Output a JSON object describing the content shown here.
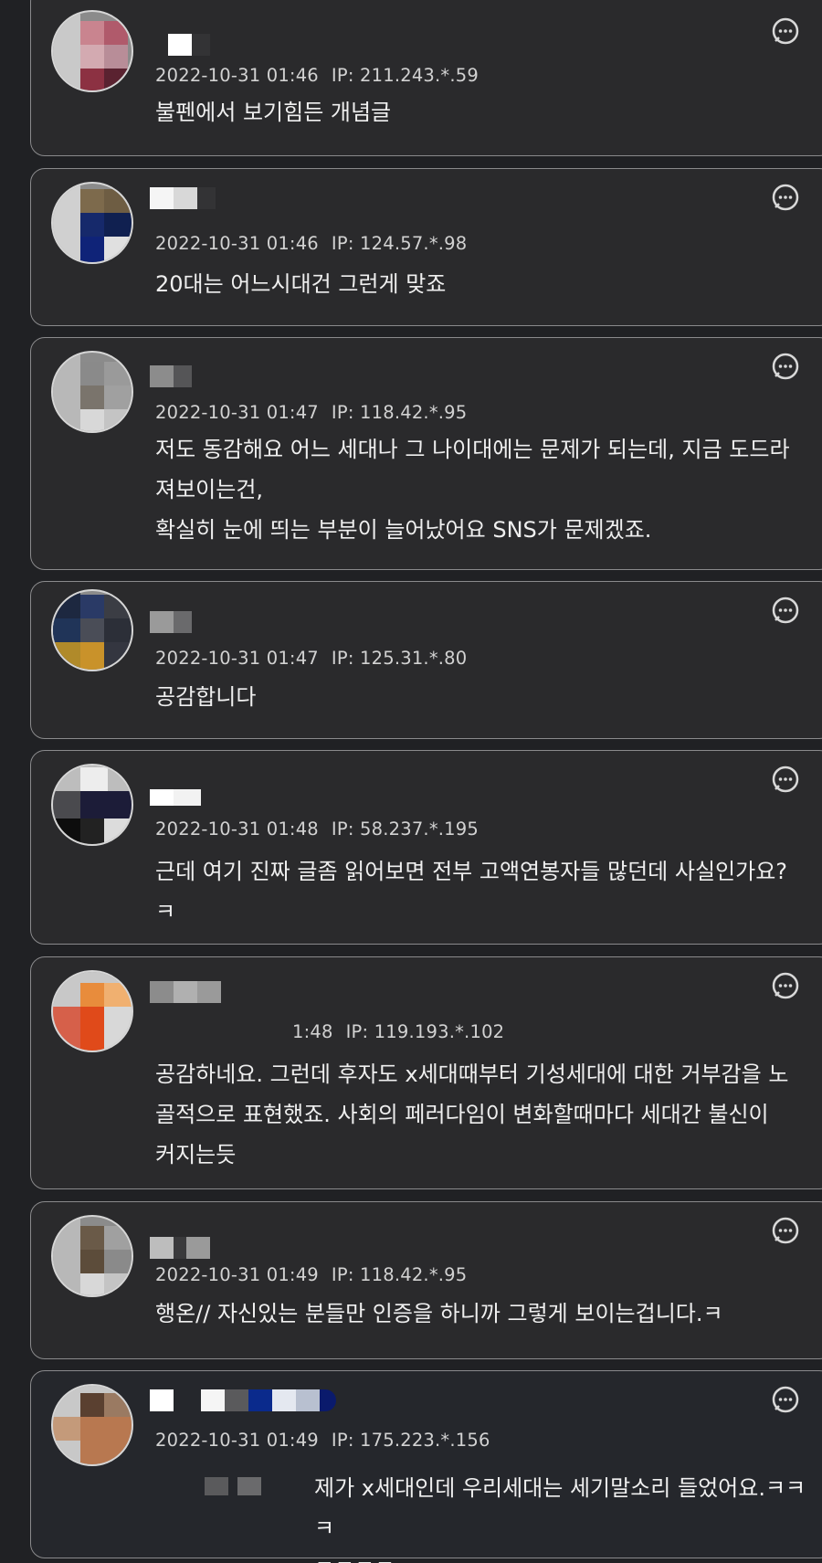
{
  "comments": [
    {
      "date": "2022-10-31 01:46",
      "ip": "IP: 211.243.*.59",
      "text": "불펜에서 보기힘든 개념글"
    },
    {
      "date": "2022-10-31 01:46",
      "ip": "IP: 124.57.*.98",
      "text": "20대는 어느시대건 그런게 맞죠"
    },
    {
      "date": "2022-10-31 01:47",
      "ip": "IP: 118.42.*.95",
      "text": "저도 동감해요 어느 세대나 그 나이대에는 문제가 되는데, 지금 도드라\n져보이는건,\n확실히 눈에 띄는 부분이 늘어났어요 SNS가 문제겠죠."
    },
    {
      "date": "2022-10-31 01:47",
      "ip": "IP: 125.31.*.80",
      "text": "공감합니다"
    },
    {
      "date": "2022-10-31 01:48",
      "ip": "IP: 58.237.*.195",
      "text": "근데 여기 진짜 글좀 읽어보면 전부 고액연봉자들 많던데 사실인가요?\nㅋ"
    },
    {
      "date": "1:48",
      "ip": "IP: 119.193.*.102",
      "text": "공감하네요. 그런데 후자도 x세대때부터 기성세대에 대한 거부감을 노\n골적으로 표현했죠. 사회의 페러다임이 변화할때마다 세대간 불신이\n커지는듯"
    },
    {
      "date": "2022-10-31 01:49",
      "ip": "IP: 118.42.*.95",
      "text": "행온// 자신있는 분들만 인증을 하니까 그렇게 보이는겁니다.ㅋ"
    },
    {
      "date": "2022-10-31 01:49",
      "ip": "IP: 175.223.*.156",
      "text": "제가 x세대인데 우리세대는 세기말소리 들었어요.ㅋㅋㅋ\nㅋㅋㅋㅋ"
    }
  ],
  "icons": {
    "more": "more-dots-bubble-icon"
  },
  "colors": {
    "background": "#202124",
    "card": "#2a2a2c",
    "border": "#8a8a8c",
    "text": "#efefef"
  }
}
